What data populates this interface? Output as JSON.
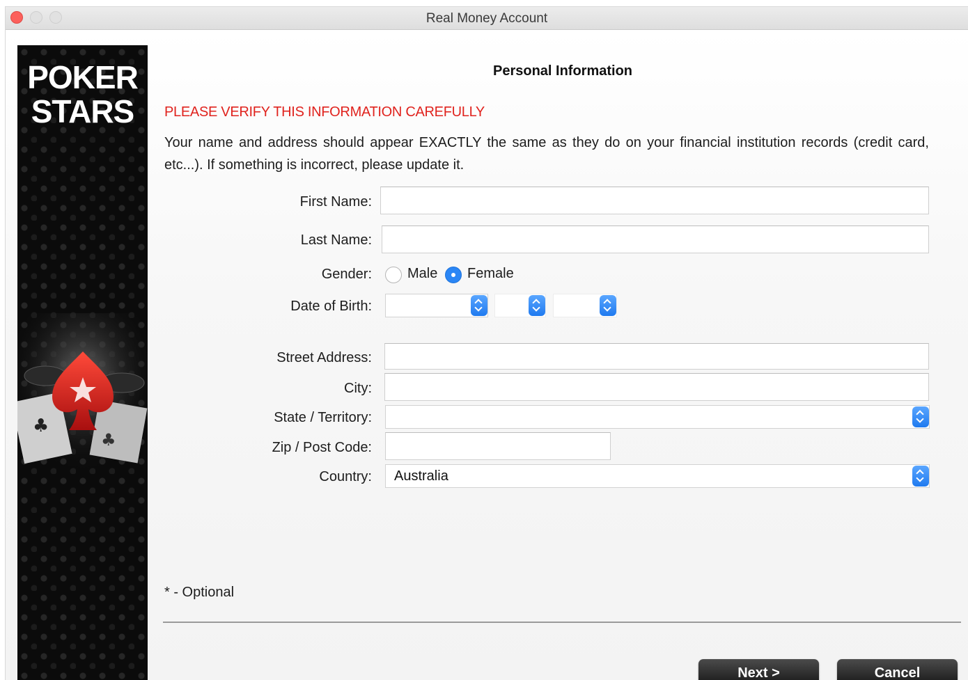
{
  "window": {
    "title": "Real Money Account"
  },
  "brand": {
    "line1": "POKER",
    "line2": "STARS"
  },
  "form": {
    "heading": "Personal Information",
    "warning": "PLEASE VERIFY THIS INFORMATION CAREFULLY",
    "intro": "Your name and address should appear EXACTLY the same as they do on your financial institution records (credit card, etc...). If something is incorrect, please update it.",
    "first_name_label": "First Name:",
    "first_name_value": "",
    "last_name_label": "Last Name:",
    "last_name_value": "",
    "gender_label": "Gender:",
    "gender_male": "Male",
    "gender_female": "Female",
    "gender_selected": "Female",
    "dob_label": "Date of Birth:",
    "dob_day": "",
    "dob_month": "",
    "dob_year": "",
    "street_label": "Street Address:",
    "street_value": "",
    "city_label": "City:",
    "city_value": "",
    "state_label": "State / Territory:",
    "state_value": "",
    "zip_label": "Zip / Post Code:",
    "zip_value": "",
    "country_label": "Country:",
    "country_value": "Australia",
    "optional_note": "* - Optional"
  },
  "buttons": {
    "next": "Next >",
    "cancel": "Cancel"
  },
  "colors": {
    "warning": "#e0231e",
    "accent": "#2b86f5",
    "sidebar": "#0b0b0b"
  }
}
